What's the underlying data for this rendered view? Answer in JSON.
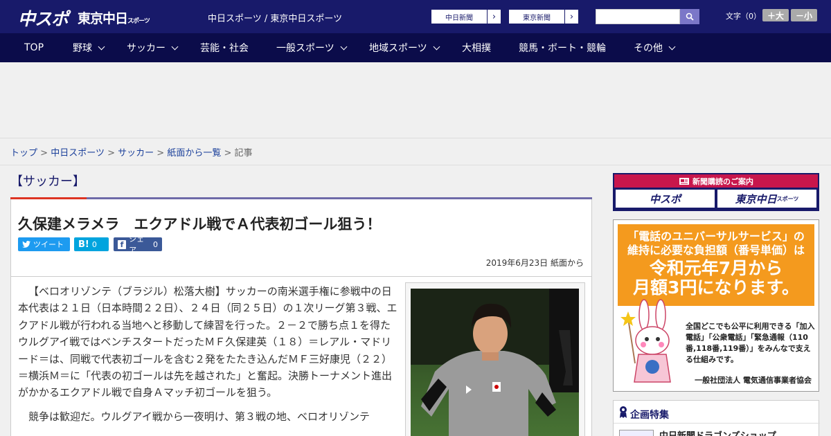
{
  "header": {
    "logo_chuspo": "中スポ",
    "logo_tokyo": "東京中日",
    "logo_tokyo_sub": "スポーツ",
    "site_title": "中日スポーツ / 東京中日スポーツ",
    "paper_buttons": [
      "中日新聞",
      "東京新聞"
    ],
    "font_size_label": "文字（0）",
    "font_larger": "＋大",
    "font_smaller": "－小"
  },
  "nav": {
    "items": [
      {
        "label": "TOP"
      },
      {
        "label": "野球"
      },
      {
        "label": "サッカー"
      },
      {
        "label": "芸能・社会"
      },
      {
        "label": "一般スポーツ"
      },
      {
        "label": "地域スポーツ"
      },
      {
        "label": "大相撲"
      },
      {
        "label": "競馬・ボート・競輪"
      },
      {
        "label": "その他"
      }
    ]
  },
  "breadcrumb": {
    "items": [
      "トップ",
      "中日スポーツ",
      "サッカー",
      "紙面から一覧"
    ],
    "separator": ">",
    "current": "記事"
  },
  "article": {
    "section": "【サッカー】",
    "headline": "久保建メラメラ　エクアドル戦でＡ代表初ゴール狙う！",
    "share": {
      "twitter": "ツイート",
      "hatena": "B!",
      "hatena_count": "0",
      "facebook": "シェア",
      "facebook_count": "0"
    },
    "date": "2019年6月23日 紙面から",
    "paragraphs": [
      "【ベロオリゾンテ（ブラジル）松落大樹】サッカーの南米選手権に参戦中の日本代表は２１日（日本時間２２日）、２４日（同２５日）の１次リーグ第３戦、エクアドル戦が行われる当地へと移動して練習を行った。２－２で勝ち点１を得たウルグアイ戦ではベンチスタートだったＭＦ久保建英（１８）＝レアル・マドリード＝は、同戦で代表初ゴールを含む２発をたたき込んだＭＦ三好康児（２２）＝横浜Ｍ＝に「代表の初ゴールは先を越された」と奮起。決勝トーナメント進出がかかるエクアドル戦で自身Ａマッチ初ゴールを狙う。",
      "競争は歓迎だ。ウルグアイ戦から一夜明け、第３戦の地、ベロオリゾンテ"
    ]
  },
  "sidebar": {
    "subscribe_header": "新聞購読のご案内",
    "subscribe_items": [
      "中スポ",
      "東京中日"
    ],
    "subscribe_tokyo_sub": "スポーツ",
    "univ_line1": "「電話のユニバーサルサービス」の",
    "univ_line2": "維持に必要な負担額（番号単価）は",
    "univ_big1": "令和元年7月から",
    "univ_big2": "月額3円になります。",
    "univ_body": "全国どこでも公平に利用できる「加入電話」「公衆電話」「緊急通報（110番,118番,119番）」をみんなで支える仕組みです。",
    "univ_org": "一般社団法人 電気通信事業者協会",
    "kikaku_title": "企画特集",
    "kikaku_item": "中日新聞ドラゴンズショップ"
  },
  "colors": {
    "brand_navy": "#181a6a",
    "nav_dark": "#0b0c4a",
    "accent_red": "#c8164c",
    "univ_orange": "#f49a1e"
  }
}
